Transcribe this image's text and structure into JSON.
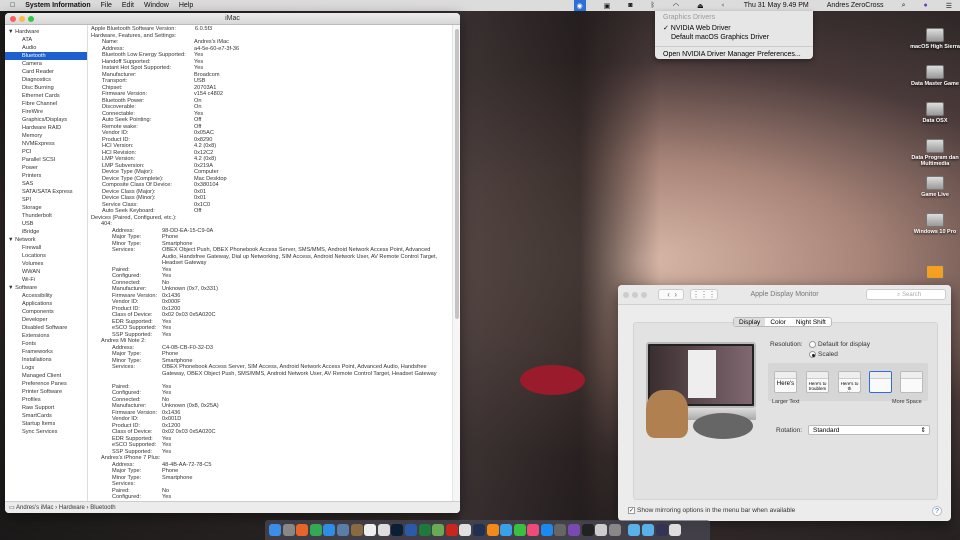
{
  "menubar": {
    "app": "System Information",
    "items": [
      "File",
      "Edit",
      "Window",
      "Help"
    ],
    "clock": "Thu 31 May  9.49 PM",
    "user": "Andres ZeroCross"
  },
  "nvidia_menu": {
    "header": "Graphics Drivers",
    "items": [
      "✓ NVIDIA Web Driver",
      "Default macOS Graphics Driver"
    ],
    "prefs": "Open NVIDIA Driver Manager Preferences..."
  },
  "sysinfo": {
    "title": "iMac",
    "sidebar": [
      {
        "group": "Hardware",
        "items": [
          "ATA",
          "Audio",
          "Bluetooth",
          "Camera",
          "Card Reader",
          "Diagnostics",
          "Disc Burning",
          "Ethernet Cards",
          "Fibre Channel",
          "FireWire",
          "Graphics/Displays",
          "Hardware RAID",
          "Memory",
          "NVMExpress",
          "PCI",
          "Parallel SCSI",
          "Power",
          "Printers",
          "SAS",
          "SATA/SATA Express",
          "SPI",
          "Storage",
          "Thunderbolt",
          "USB",
          "iBridge"
        ]
      },
      {
        "group": "Network",
        "items": [
          "Firewall",
          "Locations",
          "Volumes",
          "WWAN",
          "Wi-Fi"
        ]
      },
      {
        "group": "Software",
        "items": [
          "Accessibility",
          "Applications",
          "Components",
          "Developer",
          "Disabled Software",
          "Extensions",
          "Fonts",
          "Frameworks",
          "Installations",
          "Logs",
          "Managed Client",
          "Preference Panes",
          "Printer Software",
          "Profiles",
          "Raw Support",
          "SmartCards",
          "Startup Items",
          "Sync Services"
        ]
      }
    ],
    "selected": "Bluetooth",
    "software_version_label": "Apple Bluetooth Software Version:",
    "software_version": "6.0.5f3",
    "hw_heading": "Hardware, Features, and Settings:",
    "properties": [
      [
        "Name:",
        "Andres's iMac"
      ],
      [
        "Address:",
        "a4-5e-60-e7-3f-36"
      ],
      [
        "Bluetooth Low Energy Supported:",
        "Yes"
      ],
      [
        "Handoff Supported:",
        "Yes"
      ],
      [
        "Instant Hot Spot Supported:",
        "Yes"
      ],
      [
        "Manufacturer:",
        "Broadcom"
      ],
      [
        "Transport:",
        "USB"
      ],
      [
        "Chipset:",
        "20703A1"
      ],
      [
        "Firmware Version:",
        "v154 c4802"
      ],
      [
        "Bluetooth Power:",
        "On"
      ],
      [
        "Discoverable:",
        "On"
      ],
      [
        "Connectable:",
        "Yes"
      ],
      [
        "Auto Seek Pointing:",
        "Off"
      ],
      [
        "Remote wake:",
        "Off"
      ],
      [
        "Vendor ID:",
        "0x05AC"
      ],
      [
        "Product ID:",
        "0x8290"
      ],
      [
        "HCI Version:",
        "4.2 (0x8)"
      ],
      [
        "HCI Revision:",
        "0x12C2"
      ],
      [
        "LMP Version:",
        "4.2 (0x8)"
      ],
      [
        "LMP Subversion:",
        "0x219A"
      ],
      [
        "Device Type (Major):",
        "Computer"
      ],
      [
        "Device Type (Complete):",
        "Mac Desktop"
      ],
      [
        "Composite Class Of Device:",
        "0x380104"
      ],
      [
        "Device Class (Major):",
        "0x01"
      ],
      [
        "Device Class (Minor):",
        "0x01"
      ],
      [
        "Service Class:",
        "0x1C0"
      ],
      [
        "Auto Seek Keyboard:",
        "Off"
      ]
    ],
    "devices_heading": "Devices (Paired, Configured, etc.):",
    "devices": [
      {
        "name": "404:",
        "props": [
          [
            "Address:",
            "98-DD-EA-15-C9-0A"
          ],
          [
            "Major Type:",
            "Phone"
          ],
          [
            "Minor Type:",
            "Smartphone"
          ],
          [
            "Services:",
            "OBEX Object Push, OBEX Phonebook Access Server, SMS/MMS, Android Network Access Point, Advanced Audio, Handsfree Gateway, Dial up Networking, SIM Access, Android Network User, AV Remote Control Target, Headset Gateway"
          ],
          [
            "Paired:",
            "Yes"
          ],
          [
            "Configured:",
            "Yes"
          ],
          [
            "Connected:",
            "No"
          ],
          [
            "Manufacturer:",
            "Unknown (0x7, 0x331)"
          ],
          [
            "Firmware Version:",
            "0x1436"
          ],
          [
            "Vendor ID:",
            "0x000F"
          ],
          [
            "Product ID:",
            "0x1200"
          ],
          [
            "Class of Device:",
            "0x02 0x03 0x5A020C"
          ],
          [
            "EDR Supported:",
            "Yes"
          ],
          [
            "eSCO Supported:",
            "Yes"
          ],
          [
            "SSP Supported:",
            "Yes"
          ]
        ]
      },
      {
        "name": "Andres Mi Note 2:",
        "props": [
          [
            "Address:",
            "C4-0B-CB-F0-32-D3"
          ],
          [
            "Major Type:",
            "Phone"
          ],
          [
            "Minor Type:",
            "Smartphone"
          ],
          [
            "Services:",
            "OBEX Phonebook Access Server, SIM Access, Android Network Access Point, Advanced Audio, Handsfree Gateway, OBEX Object Push, SMS/MMS, Android Network User, AV Remote Control Target, Headset Gateway"
          ],
          [
            "Paired:",
            "Yes"
          ],
          [
            "Configured:",
            "Yes"
          ],
          [
            "Connected:",
            "No"
          ],
          [
            "Manufacturer:",
            "Unknown (0x8, 0x25A)"
          ],
          [
            "Firmware Version:",
            "0x1436"
          ],
          [
            "Vendor ID:",
            "0x001D"
          ],
          [
            "Product ID:",
            "0x1200"
          ],
          [
            "Class of Device:",
            "0x02 0x03 0x5A020C"
          ],
          [
            "EDR Supported:",
            "Yes"
          ],
          [
            "eSCO Supported:",
            "Yes"
          ],
          [
            "SSP Supported:",
            "Yes"
          ]
        ]
      },
      {
        "name": "Andres's iPhone 7 Plus:",
        "props": [
          [
            "Address:",
            "48-4B-AA-72-78-C5"
          ],
          [
            "Major Type:",
            "Phone"
          ],
          [
            "Minor Type:",
            "Smartphone"
          ],
          [
            "Services:",
            ""
          ],
          [
            "Paired:",
            "No"
          ],
          [
            "Configured:",
            "Yes"
          ],
          [
            "Connected:",
            "No"
          ]
        ]
      }
    ],
    "path": [
      "Andres's iMac",
      "Hardware",
      "Bluetooth"
    ]
  },
  "desktop_icons": [
    "macOS High Sierra",
    "Data Master Game",
    "Data OSX",
    "Data Program dan Multimedia",
    "Game Live",
    "Windows 10 Pro"
  ],
  "display": {
    "title": "Apple Display Monitor",
    "search_placeholder": "Search",
    "tabs": [
      "Display",
      "Color",
      "Night Shift"
    ],
    "active_tab": "Display",
    "resolution_label": "Resolution:",
    "options": [
      "Default for display",
      "Scaled"
    ],
    "selected_option": "Scaled",
    "scale_previews": [
      "Here's",
      "Here's to troublem",
      "Here's to th troublemak",
      "",
      ""
    ],
    "selected_scale": 3,
    "larger_text": "Larger Text",
    "more_space": "More Space",
    "rotation_label": "Rotation:",
    "rotation": "Standard",
    "mirroring": "Show mirroring options in the menu bar when available",
    "mirroring_checked": true
  },
  "dock_colors": [
    "#3a8ee6",
    "#888",
    "#e8652a",
    "#34a853",
    "#2f8de4",
    "#5b7ea8",
    "#8a6a40",
    "#eee",
    "#ddd",
    "#0a1e36",
    "#2b5aa8",
    "#1e7a3c",
    "#6aaa55",
    "#c9271d",
    "#e0e0e0",
    "#203050",
    "#f08a18",
    "#3aa0e8",
    "#3ac040",
    "#f04a7a",
    "#1a8af0",
    "#666",
    "#7a4ab0",
    "#222",
    "#ccc",
    "#888",
    "#5ab0e8",
    "#5ab0e8",
    "#335",
    "#ddd"
  ]
}
